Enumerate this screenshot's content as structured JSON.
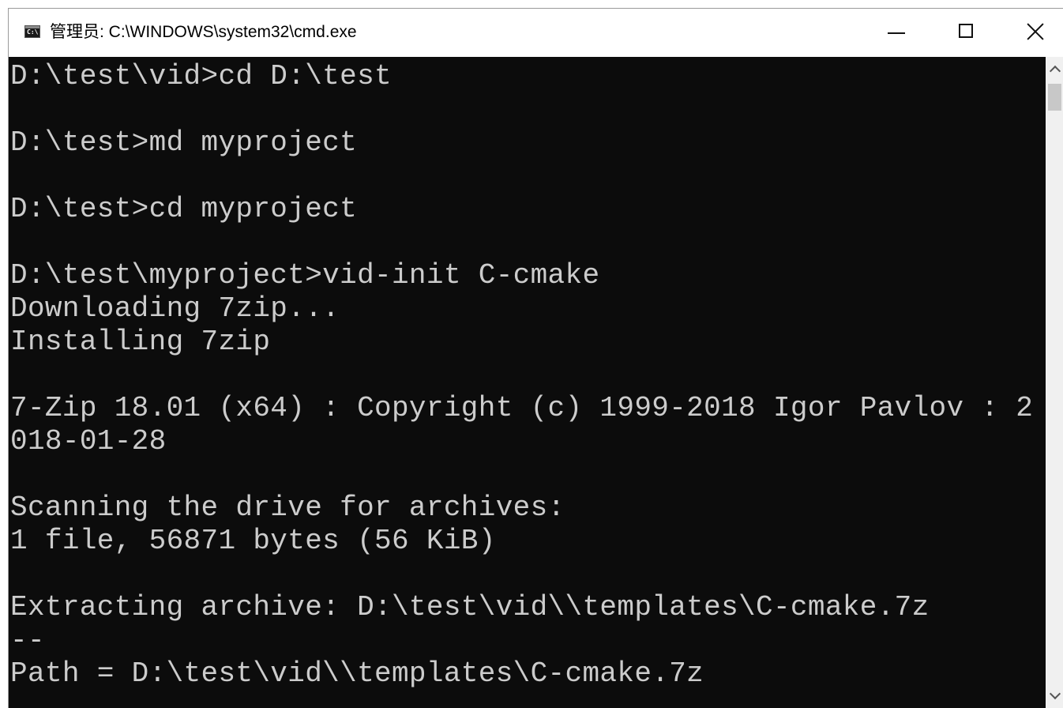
{
  "window": {
    "title": "管理员: C:\\WINDOWS\\system32\\cmd.exe",
    "icon": "cmd-app-icon",
    "icon_text": "C:\\"
  },
  "controls": {
    "minimize_icon": "minimize-icon",
    "maximize_icon": "maximize-icon",
    "close_icon": "close-icon"
  },
  "console": {
    "lines": [
      "D:\\test\\vid>cd D:\\test",
      "",
      "D:\\test>md myproject",
      "",
      "D:\\test>cd myproject",
      "",
      "D:\\test\\myproject>vid-init C-cmake",
      "Downloading 7zip...",
      "Installing 7zip",
      "",
      "7-Zip 18.01 (x64) : Copyright (c) 1999-2018 Igor Pavlov : 2",
      "018-01-28",
      "",
      "Scanning the drive for archives:",
      "1 file, 56871 bytes (56 KiB)",
      "",
      "Extracting archive: D:\\test\\vid\\\\templates\\C-cmake.7z",
      "--",
      "Path = D:\\test\\vid\\\\templates\\C-cmake.7z"
    ]
  },
  "colors": {
    "console_bg": "#0c0c0c",
    "console_fg": "#cccccc",
    "titlebar_bg": "#ffffff"
  }
}
